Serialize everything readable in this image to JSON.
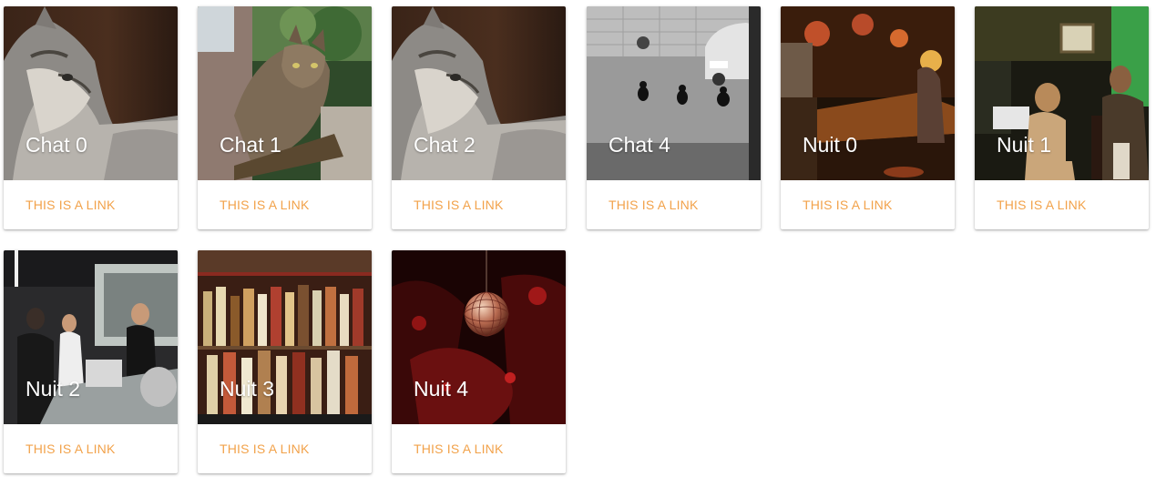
{
  "cards": [
    {
      "title": "Chat 0",
      "link": "THIS IS A LINK",
      "photo": "cat-profile-photo"
    },
    {
      "title": "Chat 1",
      "link": "THIS IS A LINK",
      "photo": "cat-walking-fence-photo"
    },
    {
      "title": "Chat 2",
      "link": "THIS IS A LINK",
      "photo": "cat-profile-photo"
    },
    {
      "title": "Chat 4",
      "link": "THIS IS A LINK",
      "photo": "three-black-cats-street-photo"
    },
    {
      "title": "Nuit 0",
      "link": "THIS IS A LINK",
      "photo": "bar-counter-photo"
    },
    {
      "title": "Nuit 1",
      "link": "THIS IS A LINK",
      "photo": "bar-patrons-photo"
    },
    {
      "title": "Nuit 2",
      "link": "THIS IS A LINK",
      "photo": "bar-staff-photo"
    },
    {
      "title": "Nuit 3",
      "link": "THIS IS A LINK",
      "photo": "liquor-shelf-photo"
    },
    {
      "title": "Nuit 4",
      "link": "THIS IS A LINK",
      "photo": "disco-ball-photo"
    }
  ],
  "colors": {
    "link": "#f2a24a",
    "title": "#ffffff",
    "card_bg": "#ffffff"
  }
}
